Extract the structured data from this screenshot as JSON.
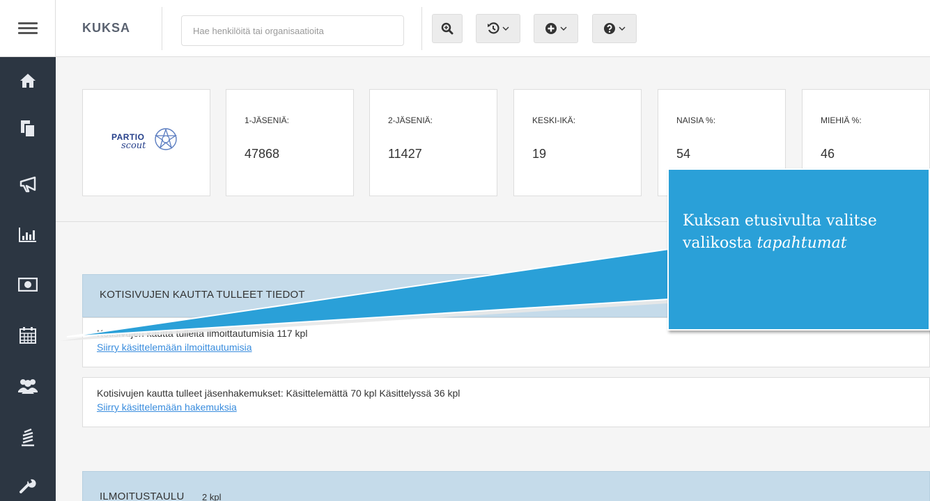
{
  "app": {
    "brand": "KUKSA"
  },
  "search": {
    "placeholder": "Hae henkilöitä tai organisaatioita"
  },
  "toolbar": {
    "buttons": [
      {
        "name": "zoom-search-icon"
      },
      {
        "name": "history-icon",
        "dropdown": true
      },
      {
        "name": "add-icon",
        "dropdown": true
      },
      {
        "name": "help-icon",
        "dropdown": true
      }
    ]
  },
  "sidebar": {
    "items": [
      {
        "icon": "home-icon"
      },
      {
        "icon": "documents-icon"
      },
      {
        "icon": "megaphone-icon"
      },
      {
        "icon": "bar-chart-icon"
      },
      {
        "icon": "money-icon"
      },
      {
        "icon": "calendar-icon"
      },
      {
        "icon": "people-icon"
      },
      {
        "icon": "education-icon"
      },
      {
        "icon": "wrench-icon"
      }
    ]
  },
  "logo": {
    "word1": "PARTIO",
    "word2": "scout"
  },
  "stats": [
    {
      "label": "1-JÄSENIÄ:",
      "value": "47868"
    },
    {
      "label": "2-JÄSENIÄ:",
      "value": "11427"
    },
    {
      "label": "KESKI-IKÄ:",
      "value": "19"
    },
    {
      "label": "NAISIA %:",
      "value": "54"
    },
    {
      "label": "MIEHIÄ %:",
      "value": "46"
    }
  ],
  "homepage_panel": {
    "title": "KOTISIVUJEN KAUTTA TULLEET TIEDOT",
    "rows": [
      {
        "text": "Kotisivujen kautta tulleita ilmoittautumisia 117 kpl",
        "link": "Siirry käsittelemään ilmoittautumisia"
      },
      {
        "text": "Kotisivujen kautta tulleet jäsenhakemukset: Käsittelemättä 70 kpl Käsittelyssä 36 kpl",
        "link": "Siirry käsittelemään hakemuksia"
      }
    ]
  },
  "notice_panel": {
    "title": "ILMOITUSTAULU",
    "count": "2 kpl"
  },
  "callout": {
    "text_plain": "Kuksan etusivulta valitse valikosta ",
    "text_italic": "tapahtumat"
  },
  "colors": {
    "sidebar": "#2c3642",
    "panel_header": "#c5dbea",
    "callout": "#2aa0d8",
    "link": "#3a8dde"
  }
}
